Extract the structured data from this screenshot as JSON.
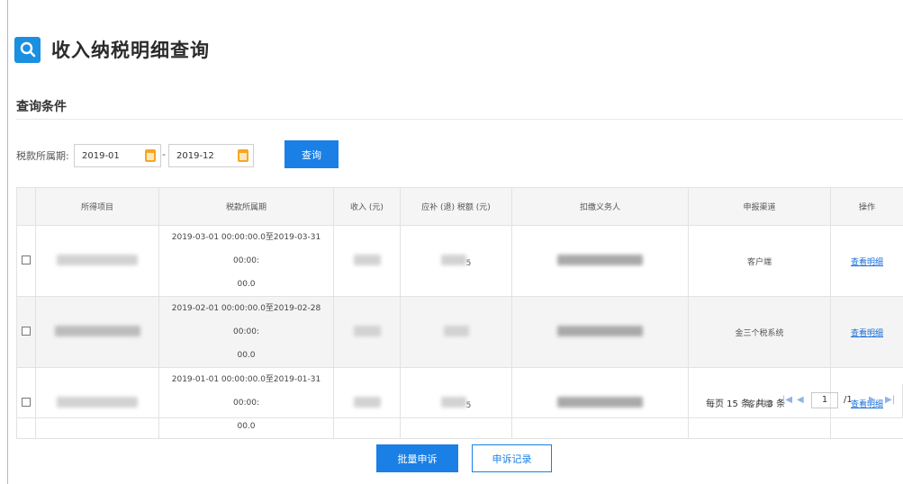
{
  "header": {
    "title": "收入纳税明细查询",
    "icon": "search-icon",
    "accent_color": "#1b8fe0"
  },
  "query": {
    "section_title": "查询条件",
    "period_label": "税款所属期:",
    "start_value": "2019-01",
    "separator": "-",
    "end_value": "2019-12",
    "calendar_icon": "calendar-icon",
    "query_button": "查询"
  },
  "table": {
    "columns": [
      "所得项目",
      "税款所属期",
      "收入 (元)",
      "应补 (退) 税额 (元)",
      "扣缴义务人",
      "申报渠道",
      "操作"
    ],
    "rows": [
      {
        "period_line1": "2019-03-01 00:00:00.0至2019-03-31 00:00:",
        "period_line2": "00.0",
        "tax_suffix": "5",
        "channel": "客户端",
        "action": "查看明细"
      },
      {
        "period_line1": "2019-02-01 00:00:00.0至2019-02-28 00:00:",
        "period_line2": "00.0",
        "tax_suffix": "",
        "channel": "金三个税系统",
        "action": "查看明细"
      },
      {
        "period_line1": "2019-01-01 00:00:00.0至2019-01-31 00:00:",
        "period_line2": "00.0",
        "tax_suffix": "5",
        "channel": "客户端",
        "action": "查看明细"
      }
    ]
  },
  "pagination": {
    "summary": "每页 15 条, 共 3 条",
    "first": "|◀",
    "prev": "◀",
    "current_page": "1",
    "total_pages": "/1",
    "next": "▶",
    "last": "▶|"
  },
  "actions": {
    "batch_appeal": "批量申诉",
    "appeal_records": "申诉记录"
  }
}
